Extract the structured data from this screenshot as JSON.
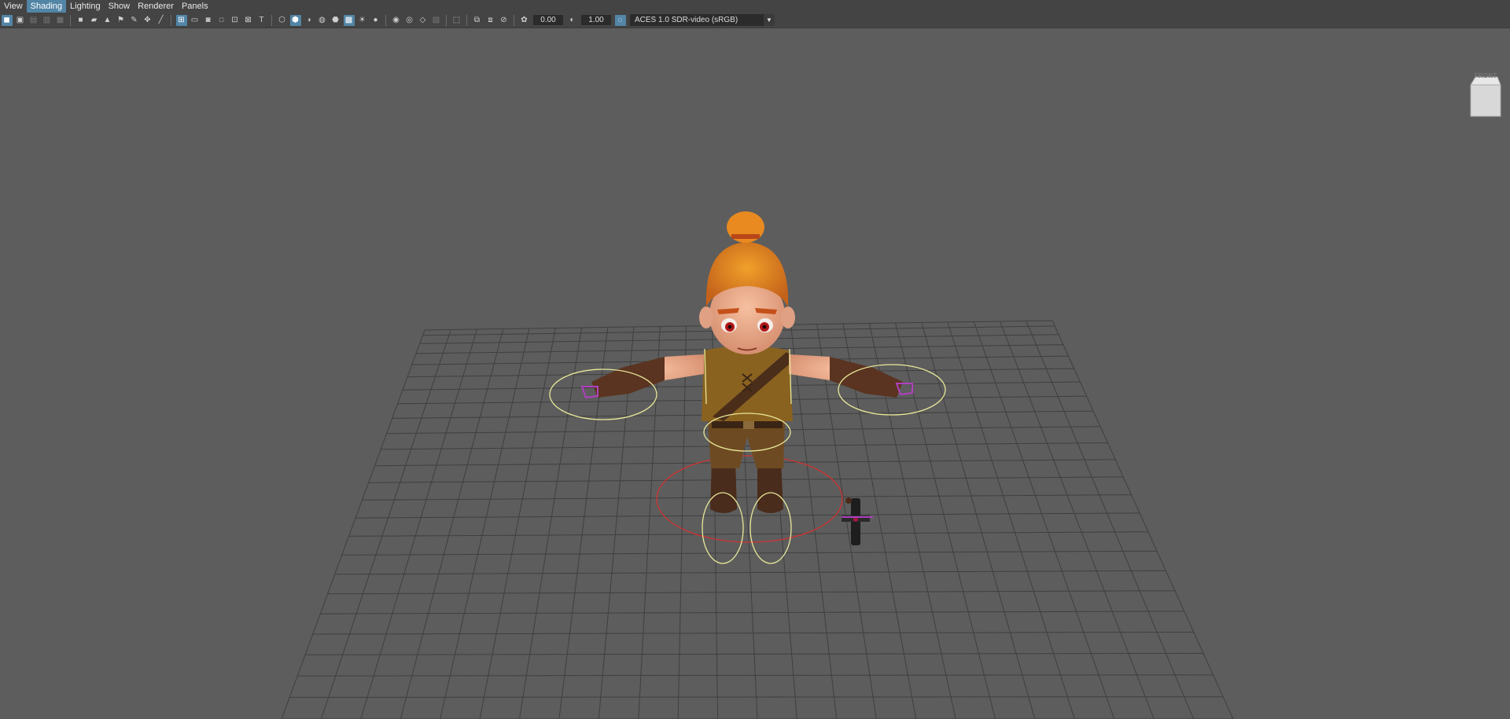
{
  "menu": {
    "items": [
      {
        "label": "View",
        "active": false
      },
      {
        "label": "Shading",
        "active": true
      },
      {
        "label": "Lighting",
        "active": false
      },
      {
        "label": "Show",
        "active": false
      },
      {
        "label": "Renderer",
        "active": false
      },
      {
        "label": "Panels",
        "active": false
      }
    ]
  },
  "toolbar": {
    "exposure_value": "0.00",
    "gamma_value": "1.00",
    "colorspace": "ACES 1.0 SDR-video (sRGB)",
    "dropdown_glyph": "▼"
  },
  "viewcube": {
    "label": "FRONT"
  },
  "colors": {
    "accent": "#5285a6",
    "viewport_bg": "#5d5d5d",
    "grid": "#3e3e3e",
    "control_yellow": "#e8e89a",
    "control_red": "#d23232",
    "control_magenta": "#b040c0"
  }
}
